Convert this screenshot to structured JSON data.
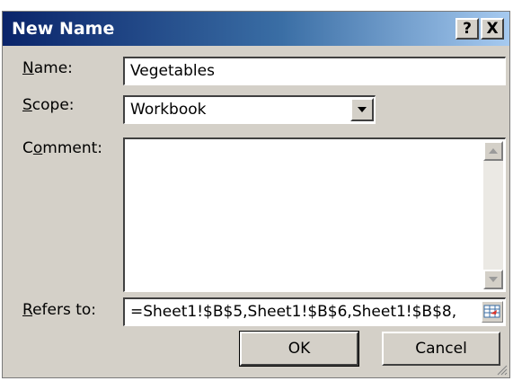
{
  "dialog": {
    "title": "New Name",
    "help_glyph": "?",
    "close_glyph": "X"
  },
  "name": {
    "label_accel": "N",
    "label_rest": "ame:",
    "value": "Vegetables"
  },
  "scope": {
    "label_accel": "S",
    "label_rest": "cope:",
    "value": "Workbook"
  },
  "comment": {
    "label_pre": "C",
    "label_accel": "o",
    "label_rest": "mment:",
    "value": ""
  },
  "refers_to": {
    "label_accel": "R",
    "label_rest": "efers to:",
    "value": "=Sheet1!$B$5,Sheet1!$B$6,Sheet1!$B$8,"
  },
  "buttons": {
    "ok": "OK",
    "cancel": "Cancel"
  },
  "icons": {
    "collapse": "range-select-icon",
    "help": "help-icon",
    "close": "close-icon"
  }
}
